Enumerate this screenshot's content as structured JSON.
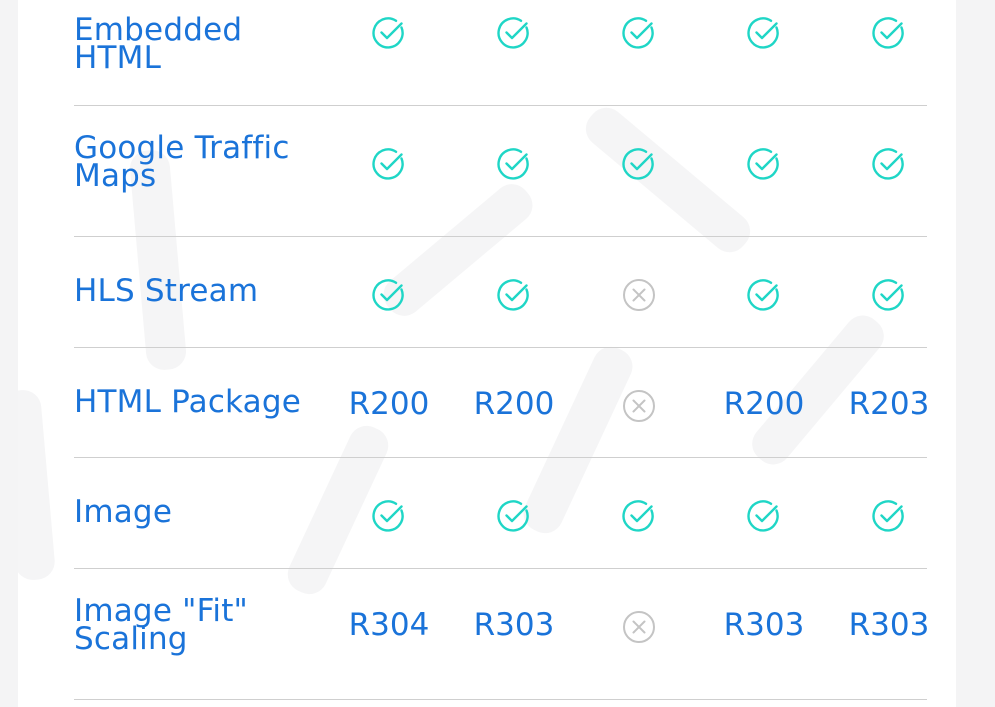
{
  "colors": {
    "feature_text": "#1a73d9",
    "check": "#1fd6c6",
    "cross": "#c4c4c4",
    "divider": "#cfcfcf"
  },
  "rows": [
    {
      "feature": [
        "Embedded",
        "HTML"
      ],
      "cells": [
        {
          "type": "check"
        },
        {
          "type": "check"
        },
        {
          "type": "check"
        },
        {
          "type": "check"
        },
        {
          "type": "check"
        }
      ]
    },
    {
      "feature": [
        "Google Traffic",
        "Maps"
      ],
      "cells": [
        {
          "type": "check"
        },
        {
          "type": "check"
        },
        {
          "type": "check"
        },
        {
          "type": "check"
        },
        {
          "type": "check"
        }
      ]
    },
    {
      "feature": [
        "HLS Stream"
      ],
      "cells": [
        {
          "type": "check"
        },
        {
          "type": "check"
        },
        {
          "type": "cross"
        },
        {
          "type": "check"
        },
        {
          "type": "check"
        }
      ]
    },
    {
      "feature": [
        "HTML Package"
      ],
      "cells": [
        {
          "type": "text",
          "value": "R200"
        },
        {
          "type": "text",
          "value": "R200"
        },
        {
          "type": "cross"
        },
        {
          "type": "text",
          "value": "R200"
        },
        {
          "type": "text",
          "value": "R203"
        }
      ]
    },
    {
      "feature": [
        "Image"
      ],
      "cells": [
        {
          "type": "check"
        },
        {
          "type": "check"
        },
        {
          "type": "check"
        },
        {
          "type": "check"
        },
        {
          "type": "check"
        }
      ]
    },
    {
      "feature": [
        "Image \"Fit\"",
        "Scaling"
      ],
      "cells": [
        {
          "type": "text",
          "value": "R304"
        },
        {
          "type": "text",
          "value": "R303"
        },
        {
          "type": "cross"
        },
        {
          "type": "text",
          "value": "R303"
        },
        {
          "type": "text",
          "value": "R303"
        }
      ]
    }
  ]
}
